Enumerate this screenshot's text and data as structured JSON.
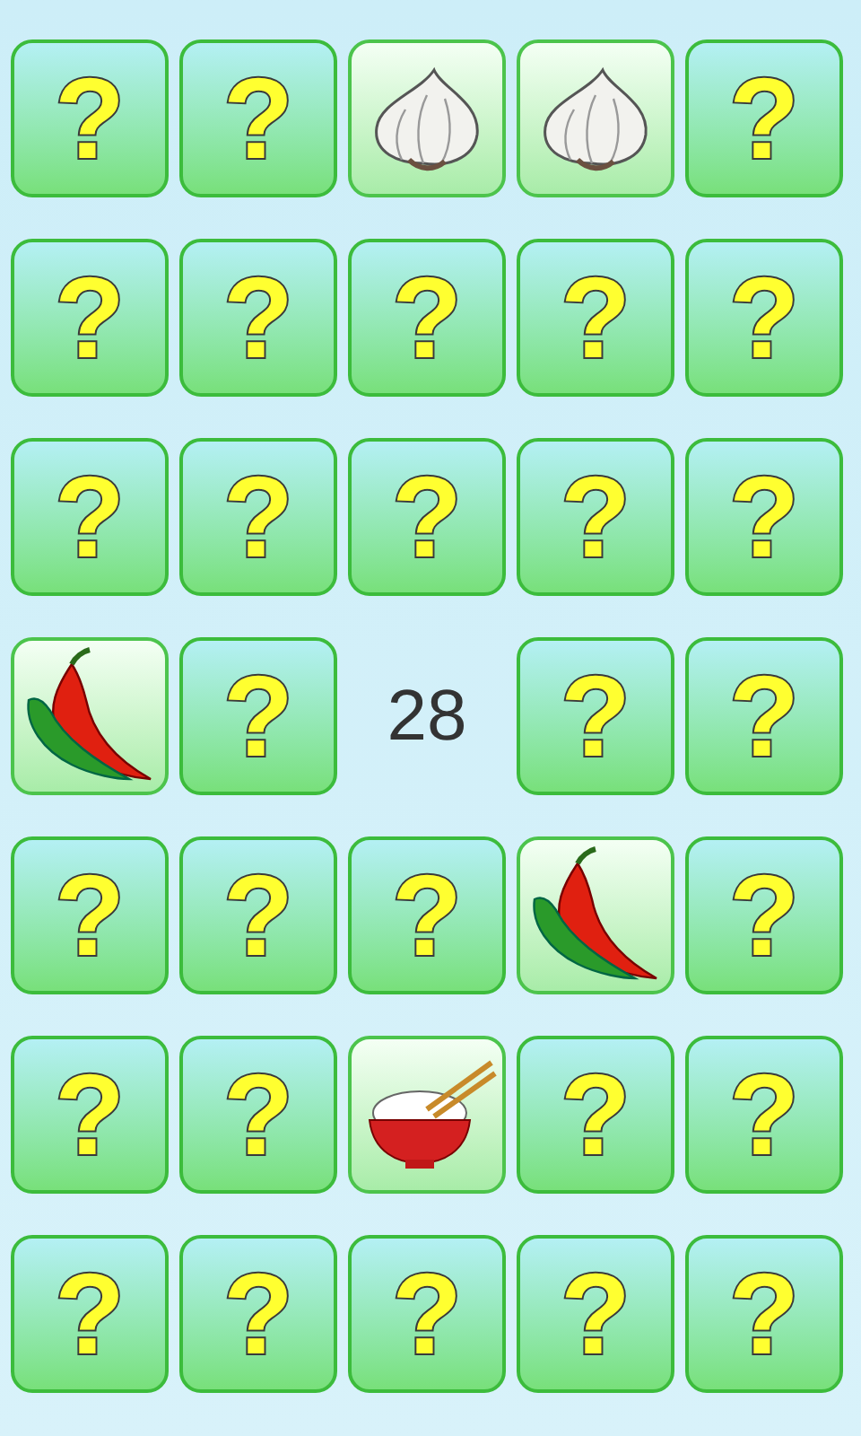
{
  "board": {
    "cards": [
      {
        "kind": "hidden",
        "label": "?"
      },
      {
        "kind": "hidden",
        "label": "?"
      },
      {
        "kind": "garlic"
      },
      {
        "kind": "garlic"
      },
      {
        "kind": "hidden",
        "label": "?"
      },
      {
        "kind": "hidden",
        "label": "?"
      },
      {
        "kind": "hidden",
        "label": "?"
      },
      {
        "kind": "hidden",
        "label": "?"
      },
      {
        "kind": "hidden",
        "label": "?"
      },
      {
        "kind": "hidden",
        "label": "?"
      },
      {
        "kind": "hidden",
        "label": "?"
      },
      {
        "kind": "hidden",
        "label": "?"
      },
      {
        "kind": "hidden",
        "label": "?"
      },
      {
        "kind": "hidden",
        "label": "?"
      },
      {
        "kind": "hidden",
        "label": "?"
      },
      {
        "kind": "chili"
      },
      {
        "kind": "hidden",
        "label": "?"
      },
      {
        "kind": "counter",
        "label": "28"
      },
      {
        "kind": "hidden",
        "label": "?"
      },
      {
        "kind": "hidden",
        "label": "?"
      },
      {
        "kind": "hidden",
        "label": "?"
      },
      {
        "kind": "hidden",
        "label": "?"
      },
      {
        "kind": "hidden",
        "label": "?"
      },
      {
        "kind": "chili"
      },
      {
        "kind": "hidden",
        "label": "?"
      },
      {
        "kind": "hidden",
        "label": "?"
      },
      {
        "kind": "hidden",
        "label": "?"
      },
      {
        "kind": "rice"
      },
      {
        "kind": "hidden",
        "label": "?"
      },
      {
        "kind": "hidden",
        "label": "?"
      },
      {
        "kind": "hidden",
        "label": "?"
      },
      {
        "kind": "hidden",
        "label": "?"
      },
      {
        "kind": "hidden",
        "label": "?"
      },
      {
        "kind": "hidden",
        "label": "?"
      },
      {
        "kind": "hidden",
        "label": "?"
      }
    ]
  }
}
